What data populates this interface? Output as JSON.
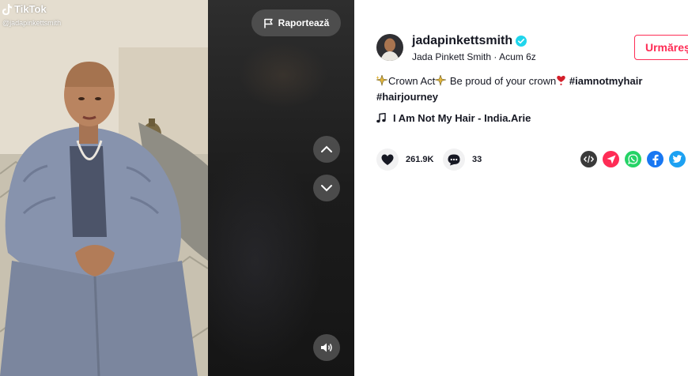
{
  "brand": {
    "name": "TikTok",
    "handle": "@jadapinkettsmith"
  },
  "video": {
    "report_label": "Raportează",
    "icons": {
      "report": "flag-icon",
      "prev": "chevron-up-icon",
      "next": "chevron-down-icon",
      "sound": "speaker-icon"
    }
  },
  "author": {
    "username": "jadapinkettsmith",
    "verified": true,
    "display_name": "Jada Pinkett Smith",
    "separator": " · ",
    "time": "Acum 6z",
    "follow_label": "Urmărește"
  },
  "description": {
    "text_1": "Crown Act",
    "text_2": " Be proud of your crown",
    "tag_1": "#iamnotmyhair",
    "tag_2": "#hairjourney"
  },
  "music": {
    "label": "I Am Not My Hair - India.Arie"
  },
  "stats": {
    "likes": "261.9K",
    "comments": "33"
  },
  "share": [
    "embed-icon",
    "send-icon",
    "whatsapp-icon",
    "facebook-icon",
    "twitter-icon"
  ],
  "colors": {
    "accent": "#fe2c55",
    "verified": "#20d5ec",
    "whatsapp": "#25d366",
    "facebook": "#1877f2",
    "twitter": "#1da1f2",
    "embed": "#3a3a3a",
    "send": "#fe2c55"
  }
}
